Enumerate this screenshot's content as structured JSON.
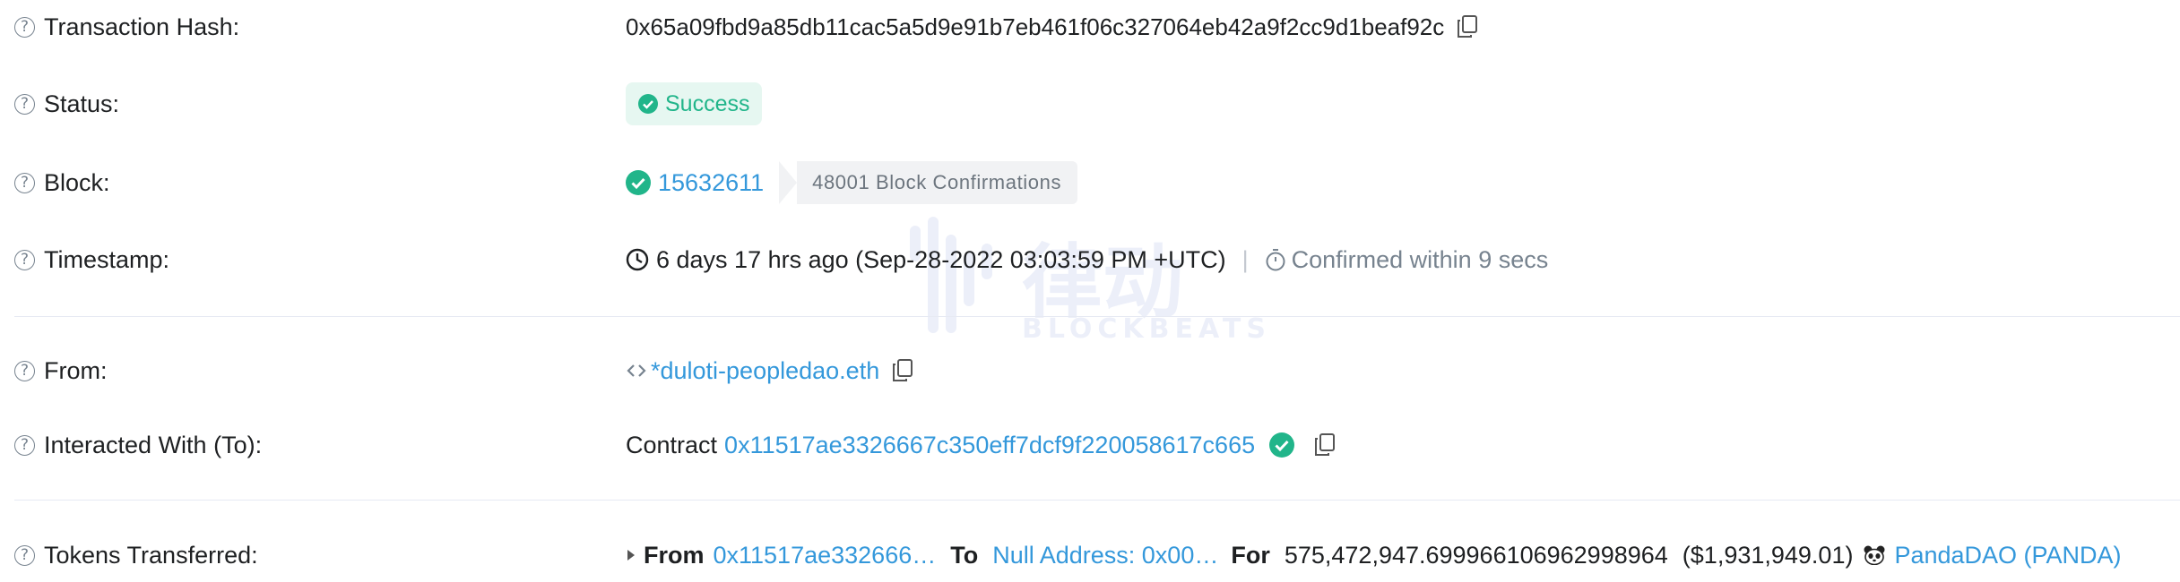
{
  "rows": {
    "tx_hash": {
      "label": "Transaction Hash:",
      "value": "0x65a09fbd9a85db11cac5a5d9e91b7eb461f06c327064eb42a9f2cc9d1beaf92c"
    },
    "status": {
      "label": "Status:",
      "value": "Success"
    },
    "block": {
      "label": "Block:",
      "number": "15632611",
      "confirmations": "48001 Block Confirmations"
    },
    "timestamp": {
      "label": "Timestamp:",
      "value": "6 days 17 hrs ago (Sep-28-2022 03:03:59 PM +UTC)",
      "separator": "|",
      "confirmed": "Confirmed within 9 secs"
    },
    "from": {
      "label": "From:",
      "value": "*duloti-peopledao.eth"
    },
    "interacted": {
      "label": "Interacted With (To):",
      "prefix": "Contract",
      "address": "0x11517ae3326667c350eff7dcf9f220058617c665"
    },
    "tokens": {
      "label": "Tokens Transferred:",
      "from_label": "From",
      "from_address": "0x11517ae332666…",
      "to_label": "To",
      "to_address": "Null Address: 0x00…",
      "for_label": "For",
      "amount": "575,472,947.699966106962998964",
      "usd": "($1,931,949.01)",
      "token": "PandaDAO (PANDA)"
    }
  },
  "watermark": {
    "text": "BLOCKBEATS",
    "cn": "律动"
  },
  "colors": {
    "link": "#3498db",
    "success": "#21b58a",
    "muted": "#77838f"
  }
}
